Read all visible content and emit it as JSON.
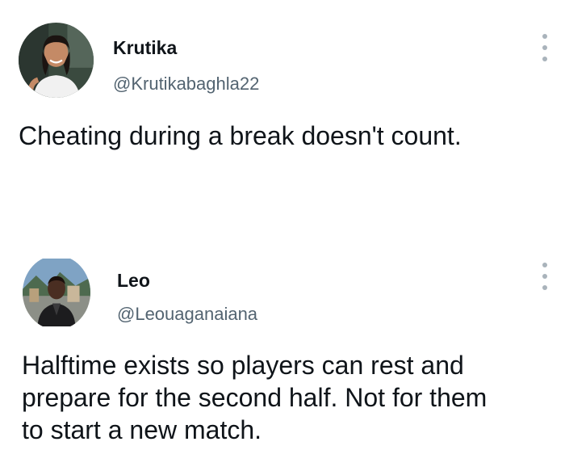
{
  "tweets": [
    {
      "author_name": "Krutika",
      "author_handle": "@Krutikabaghla22",
      "avatar_icon": "profile-photo",
      "more_icon": "vertical-ellipsis-icon",
      "text": "Cheating during a break doesn't count."
    },
    {
      "author_name": "Leo",
      "author_handle": "@Leouaganaiana",
      "avatar_icon": "profile-photo",
      "more_icon": "vertical-ellipsis-icon",
      "text_lines": [
        "Halftime exists so players can rest and",
        "prepare for the second half. Not for them",
        "to start a new match."
      ]
    }
  ],
  "colors": {
    "text_primary": "#0f1419",
    "text_secondary": "#536471",
    "icon_muted": "#a9b3bb",
    "background": "#ffffff"
  }
}
